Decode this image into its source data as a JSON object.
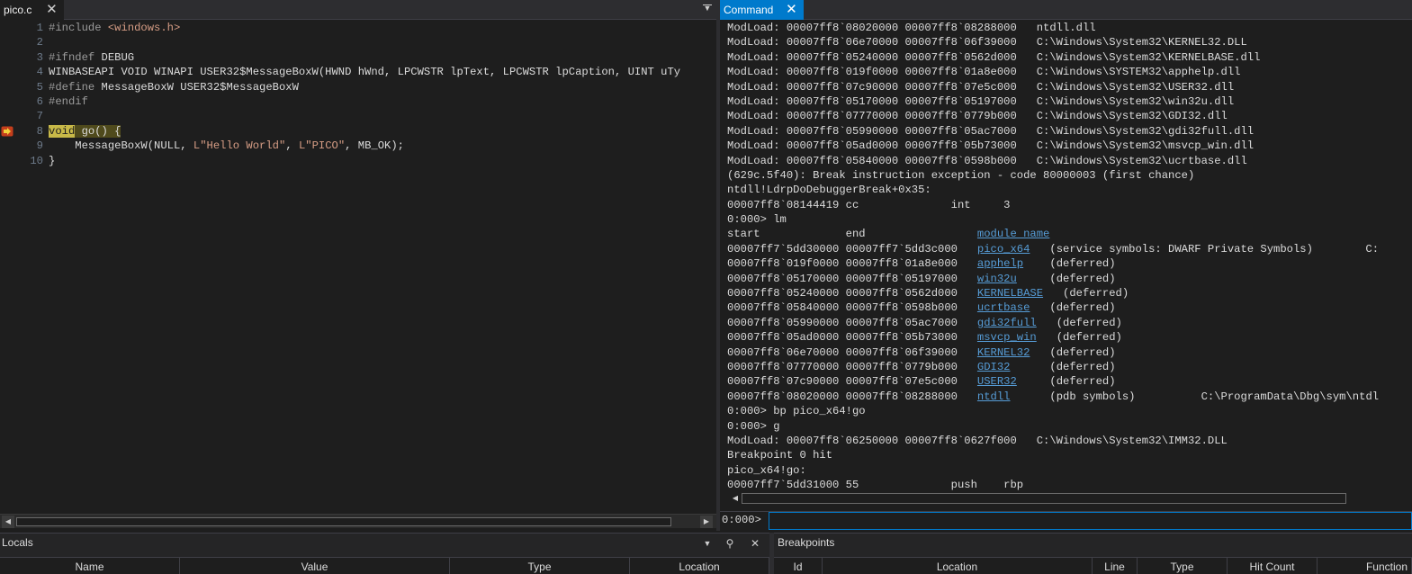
{
  "editor": {
    "tab_title": "pico.c",
    "line_numbers": [
      "1",
      "2",
      "3",
      "4",
      "5",
      "6",
      "7",
      "8",
      "9",
      "10"
    ],
    "lines": [
      [
        {
          "t": "#include ",
          "c": "pp"
        },
        {
          "t": "<windows.h>",
          "c": "inc"
        }
      ],
      [],
      [
        {
          "t": "#ifndef ",
          "c": "pp"
        },
        {
          "t": "DEBUG",
          "c": "plain"
        }
      ],
      [
        {
          "t": "WINBASEAPI VOID WINAPI USER32$MessageBoxW(HWND hWnd, LPCWSTR lpText, LPCWSTR lpCaption, UINT uTy",
          "c": "plain"
        }
      ],
      [
        {
          "t": "#define ",
          "c": "pp"
        },
        {
          "t": "MessageBoxW USER32$MessageBoxW",
          "c": "plain"
        }
      ],
      [
        {
          "t": "#endif",
          "c": "pp"
        }
      ],
      [],
      [
        {
          "t": "void",
          "c": "hl-void"
        },
        {
          "t": " go() {",
          "c": "hl-rest"
        }
      ],
      [
        {
          "t": "    MessageBoxW(NULL, ",
          "c": "plain"
        },
        {
          "t": "L\"Hello World\"",
          "c": "str"
        },
        {
          "t": ", ",
          "c": "plain"
        },
        {
          "t": "L\"PICO\"",
          "c": "str"
        },
        {
          "t": ", MB_OK);",
          "c": "plain"
        }
      ],
      [
        {
          "t": "}",
          "c": "plain"
        }
      ]
    ],
    "current_line": 8
  },
  "command": {
    "tab_title": "Command",
    "output": [
      [
        {
          "t": "ModLoad: 00007ff8`08020000 00007ff8`08288000   ntdll.dll"
        }
      ],
      [
        {
          "t": "ModLoad: 00007ff8`06e70000 00007ff8`06f39000   C:\\Windows\\System32\\KERNEL32.DLL"
        }
      ],
      [
        {
          "t": "ModLoad: 00007ff8`05240000 00007ff8`0562d000   C:\\Windows\\System32\\KERNELBASE.dll"
        }
      ],
      [
        {
          "t": "ModLoad: 00007ff8`019f0000 00007ff8`01a8e000   C:\\Windows\\SYSTEM32\\apphelp.dll"
        }
      ],
      [
        {
          "t": "ModLoad: 00007ff8`07c90000 00007ff8`07e5c000   C:\\Windows\\System32\\USER32.dll"
        }
      ],
      [
        {
          "t": "ModLoad: 00007ff8`05170000 00007ff8`05197000   C:\\Windows\\System32\\win32u.dll"
        }
      ],
      [
        {
          "t": "ModLoad: 00007ff8`07770000 00007ff8`0779b000   C:\\Windows\\System32\\GDI32.dll"
        }
      ],
      [
        {
          "t": "ModLoad: 00007ff8`05990000 00007ff8`05ac7000   C:\\Windows\\System32\\gdi32full.dll"
        }
      ],
      [
        {
          "t": "ModLoad: 00007ff8`05ad0000 00007ff8`05b73000   C:\\Windows\\System32\\msvcp_win.dll"
        }
      ],
      [
        {
          "t": "ModLoad: 00007ff8`05840000 00007ff8`0598b000   C:\\Windows\\System32\\ucrtbase.dll"
        }
      ],
      [
        {
          "t": "(629c.5f40): Break instruction exception - code 80000003 (first chance)"
        }
      ],
      [
        {
          "t": "ntdll!LdrpDoDebuggerBreak+0x35:"
        }
      ],
      [
        {
          "t": "00007ff8`08144419 cc              int     3"
        }
      ],
      [
        {
          "t": "0:000> lm"
        }
      ],
      [
        {
          "t": "start             end                 "
        },
        {
          "t": "module name",
          "link": true
        }
      ],
      [
        {
          "t": "00007ff7`5dd30000 00007ff7`5dd3c000   "
        },
        {
          "t": "pico_x64",
          "link": true
        },
        {
          "t": "   (service symbols: DWARF Private Symbols)        C:"
        }
      ],
      [
        {
          "t": "00007ff8`019f0000 00007ff8`01a8e000   "
        },
        {
          "t": "apphelp",
          "link": true
        },
        {
          "t": "    (deferred)"
        }
      ],
      [
        {
          "t": "00007ff8`05170000 00007ff8`05197000   "
        },
        {
          "t": "win32u",
          "link": true
        },
        {
          "t": "     (deferred)"
        }
      ],
      [
        {
          "t": "00007ff8`05240000 00007ff8`0562d000   "
        },
        {
          "t": "KERNELBASE",
          "link": true
        },
        {
          "t": "   (deferred)"
        }
      ],
      [
        {
          "t": "00007ff8`05840000 00007ff8`0598b000   "
        },
        {
          "t": "ucrtbase",
          "link": true
        },
        {
          "t": "   (deferred)"
        }
      ],
      [
        {
          "t": "00007ff8`05990000 00007ff8`05ac7000   "
        },
        {
          "t": "gdi32full",
          "link": true
        },
        {
          "t": "   (deferred)"
        }
      ],
      [
        {
          "t": "00007ff8`05ad0000 00007ff8`05b73000   "
        },
        {
          "t": "msvcp_win",
          "link": true
        },
        {
          "t": "   (deferred)"
        }
      ],
      [
        {
          "t": "00007ff8`06e70000 00007ff8`06f39000   "
        },
        {
          "t": "KERNEL32",
          "link": true
        },
        {
          "t": "   (deferred)"
        }
      ],
      [
        {
          "t": "00007ff8`07770000 00007ff8`0779b000   "
        },
        {
          "t": "GDI32",
          "link": true
        },
        {
          "t": "      (deferred)"
        }
      ],
      [
        {
          "t": "00007ff8`07c90000 00007ff8`07e5c000   "
        },
        {
          "t": "USER32",
          "link": true
        },
        {
          "t": "     (deferred)"
        }
      ],
      [
        {
          "t": "00007ff8`08020000 00007ff8`08288000   "
        },
        {
          "t": "ntdll",
          "link": true
        },
        {
          "t": "      (pdb symbols)          C:\\ProgramData\\Dbg\\sym\\ntdl"
        }
      ],
      [
        {
          "t": "0:000> bp pico_x64!go"
        }
      ],
      [
        {
          "t": "0:000> g"
        }
      ],
      [
        {
          "t": "ModLoad: 00007ff8`06250000 00007ff8`0627f000   C:\\Windows\\System32\\IMM32.DLL"
        }
      ],
      [
        {
          "t": "Breakpoint 0 hit"
        }
      ],
      [
        {
          "t": "pico_x64!go:"
        }
      ],
      [
        {
          "t": "00007ff7`5dd31000 55              push    rbp"
        }
      ]
    ],
    "prompt": "0:000>",
    "input_value": ""
  },
  "locals": {
    "title": "Locals",
    "columns": [
      "Name",
      "Value",
      "Type",
      "Location"
    ]
  },
  "breakpoints": {
    "title": "Breakpoints",
    "columns": [
      "Id",
      "Location",
      "Line",
      "Type",
      "Hit Count",
      "Function"
    ]
  },
  "colors": {
    "accent": "#007acc",
    "background": "#1e1e1e",
    "link": "#569cd6",
    "string": "#d69d85",
    "current_line_highlight": "#c8b948"
  }
}
